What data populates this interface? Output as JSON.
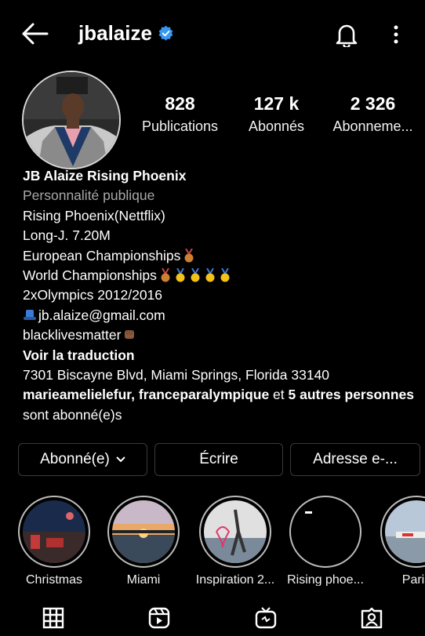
{
  "header": {
    "username": "jbalaize"
  },
  "stats": [
    {
      "value": "828",
      "label": "Publications"
    },
    {
      "value": "127 k",
      "label": "Abonnés"
    },
    {
      "value": "2 326",
      "label": "Abonneme..."
    }
  ],
  "bio": {
    "name": "JB Alaize Rising Phoenix",
    "category": "Personnalité publique",
    "line1": "Rising Phoenix(Nettflix)",
    "line2": "Long-J. 7.20M",
    "line3": "European Championships",
    "line4": "World Championships",
    "line5": "2xOlympics 2012/2016",
    "line6": "jb.alaize@gmail.com",
    "line7": "blacklivesmatter",
    "translate": "Voir la traduction",
    "address": "7301 Biscayne Blvd, Miami Springs, Florida 33140",
    "followers": {
      "user1": "marieamelielefur",
      "sep": ", ",
      "user2": "franceparalympique",
      "and": " et ",
      "others": "5 autres personnes",
      "suffix": " sont abonné(e)s"
    }
  },
  "actions": {
    "following": "Abonné(e)",
    "message": "Écrire",
    "email": "Adresse e-..."
  },
  "highlights": [
    {
      "label": "Christmas"
    },
    {
      "label": "Miami"
    },
    {
      "label": "Inspiration 2..."
    },
    {
      "label": "Rising phoe..."
    },
    {
      "label": "Paris"
    }
  ],
  "colors": {
    "verified": "#3897f0",
    "background": "#000000",
    "muted": "#a8a8a8"
  },
  "icons": {
    "back": "arrow-left-icon",
    "verified": "verified-badge-icon",
    "bell": "bell-icon",
    "more": "more-vertical-icon",
    "tabs": [
      "grid-icon",
      "reels-icon",
      "igtv-icon",
      "tagged-icon"
    ]
  }
}
